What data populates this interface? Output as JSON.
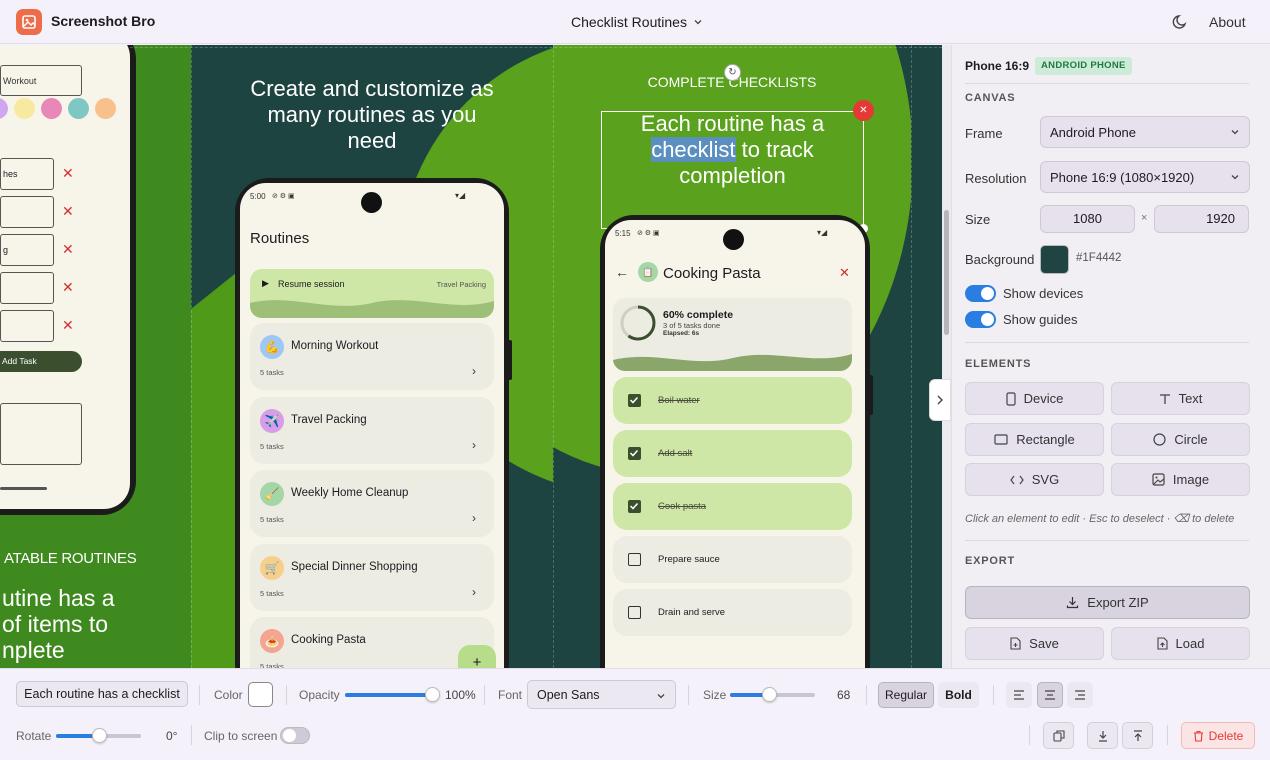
{
  "header": {
    "app_name": "Screenshot Bro",
    "doc_title": "Checklist Routines",
    "about": "About"
  },
  "canvas": {
    "bg": "#1F4442",
    "panel1": {
      "placeholder": "Workout",
      "colors": [
        "#f7c7e8",
        "#f3a3c5",
        "#f8e9a0",
        "#e888b8",
        "#7fc7c3",
        "#f8c08a"
      ],
      "tasks": [
        "hes",
        "",
        "g",
        "",
        ""
      ],
      "add_task": "Add Task",
      "label": "ATABLE ROUTINES",
      "heading": [
        "utine has a",
        "of items to",
        "nplete"
      ]
    },
    "panel2": {
      "heading": [
        "Create and customize as",
        "many routines as you",
        "need"
      ],
      "phone": {
        "status": "5:00",
        "title": "Routines",
        "resume": "Resume session",
        "resume_tag": "Travel Packing",
        "items": [
          {
            "name": "Morning Workout",
            "sub": "5 tasks",
            "emoji": "💪",
            "bg": "#9fc7f5"
          },
          {
            "name": "Travel Packing",
            "sub": "5 tasks",
            "emoji": "✈️",
            "bg": "#d89ce9"
          },
          {
            "name": "Weekly Home Cleanup",
            "sub": "5 tasks",
            "emoji": "🧹",
            "bg": "#a5d6a7"
          },
          {
            "name": "Special Dinner Shopping",
            "sub": "5 tasks",
            "emoji": "🛒",
            "bg": "#f8cf8a"
          },
          {
            "name": "Cooking Pasta",
            "sub": "5 tasks",
            "emoji": "🍝",
            "bg": "#f5a48f"
          }
        ],
        "fab": "+"
      }
    },
    "panel3": {
      "label": "COMPLETE CHECKLISTS",
      "heading_a": "Each routine has a",
      "heading_hl": "checklist",
      "heading_b": "to track",
      "heading_c": "completion",
      "phone": {
        "status": "5:15",
        "title": "Cooking Pasta",
        "progress_title": "60% complete",
        "progress_sub": "3 of 5 tasks done",
        "elapsed": "Elapsed: 6s",
        "progress_value": 0.6,
        "tasks": [
          {
            "label": "Boil water",
            "done": true
          },
          {
            "label": "Add salt",
            "done": true
          },
          {
            "label": "Cook pasta",
            "done": true
          },
          {
            "label": "Prepare sauce",
            "done": false
          },
          {
            "label": "Drain and serve",
            "done": false
          }
        ]
      }
    }
  },
  "sidebar": {
    "preset": "Phone 16:9",
    "badge": "ANDROID PHONE",
    "canvas_section": "CANVAS",
    "frame_label": "Frame",
    "frame_value": "Android Phone",
    "res_label": "Resolution",
    "res_value": "Phone 16:9 (1080×1920)",
    "size_label": "Size",
    "width": "1080",
    "times": "×",
    "height": "1920",
    "bg_label": "Background",
    "bg_value": "#1F4442",
    "bg_color": "#1F4442",
    "show_devices": "Show devices",
    "show_guides": "Show guides",
    "elements_section": "ELEMENTS",
    "elements": [
      "Device",
      "Text",
      "Rectangle",
      "Circle",
      "SVG",
      "Image"
    ],
    "hint": "Click an element to edit · Esc to deselect · ⌫ to delete",
    "export_section": "EXPORT",
    "export_zip": "Export ZIP",
    "save": "Save",
    "load": "Load"
  },
  "toolbar": {
    "element_name": "Each routine has a checklist",
    "color_label": "Color",
    "opacity_label": "Opacity",
    "opacity_value": "100%",
    "opacity": 1.0,
    "font_label": "Font",
    "font_value": "Open Sans",
    "size_label": "Size",
    "size_value": "68",
    "size_fraction": 0.46,
    "regular": "Regular",
    "bold": "Bold",
    "rotate_label": "Rotate",
    "rotate_value": "0°",
    "rotate_fraction": 0.5,
    "clip_label": "Clip to screen",
    "delete": "Delete"
  }
}
